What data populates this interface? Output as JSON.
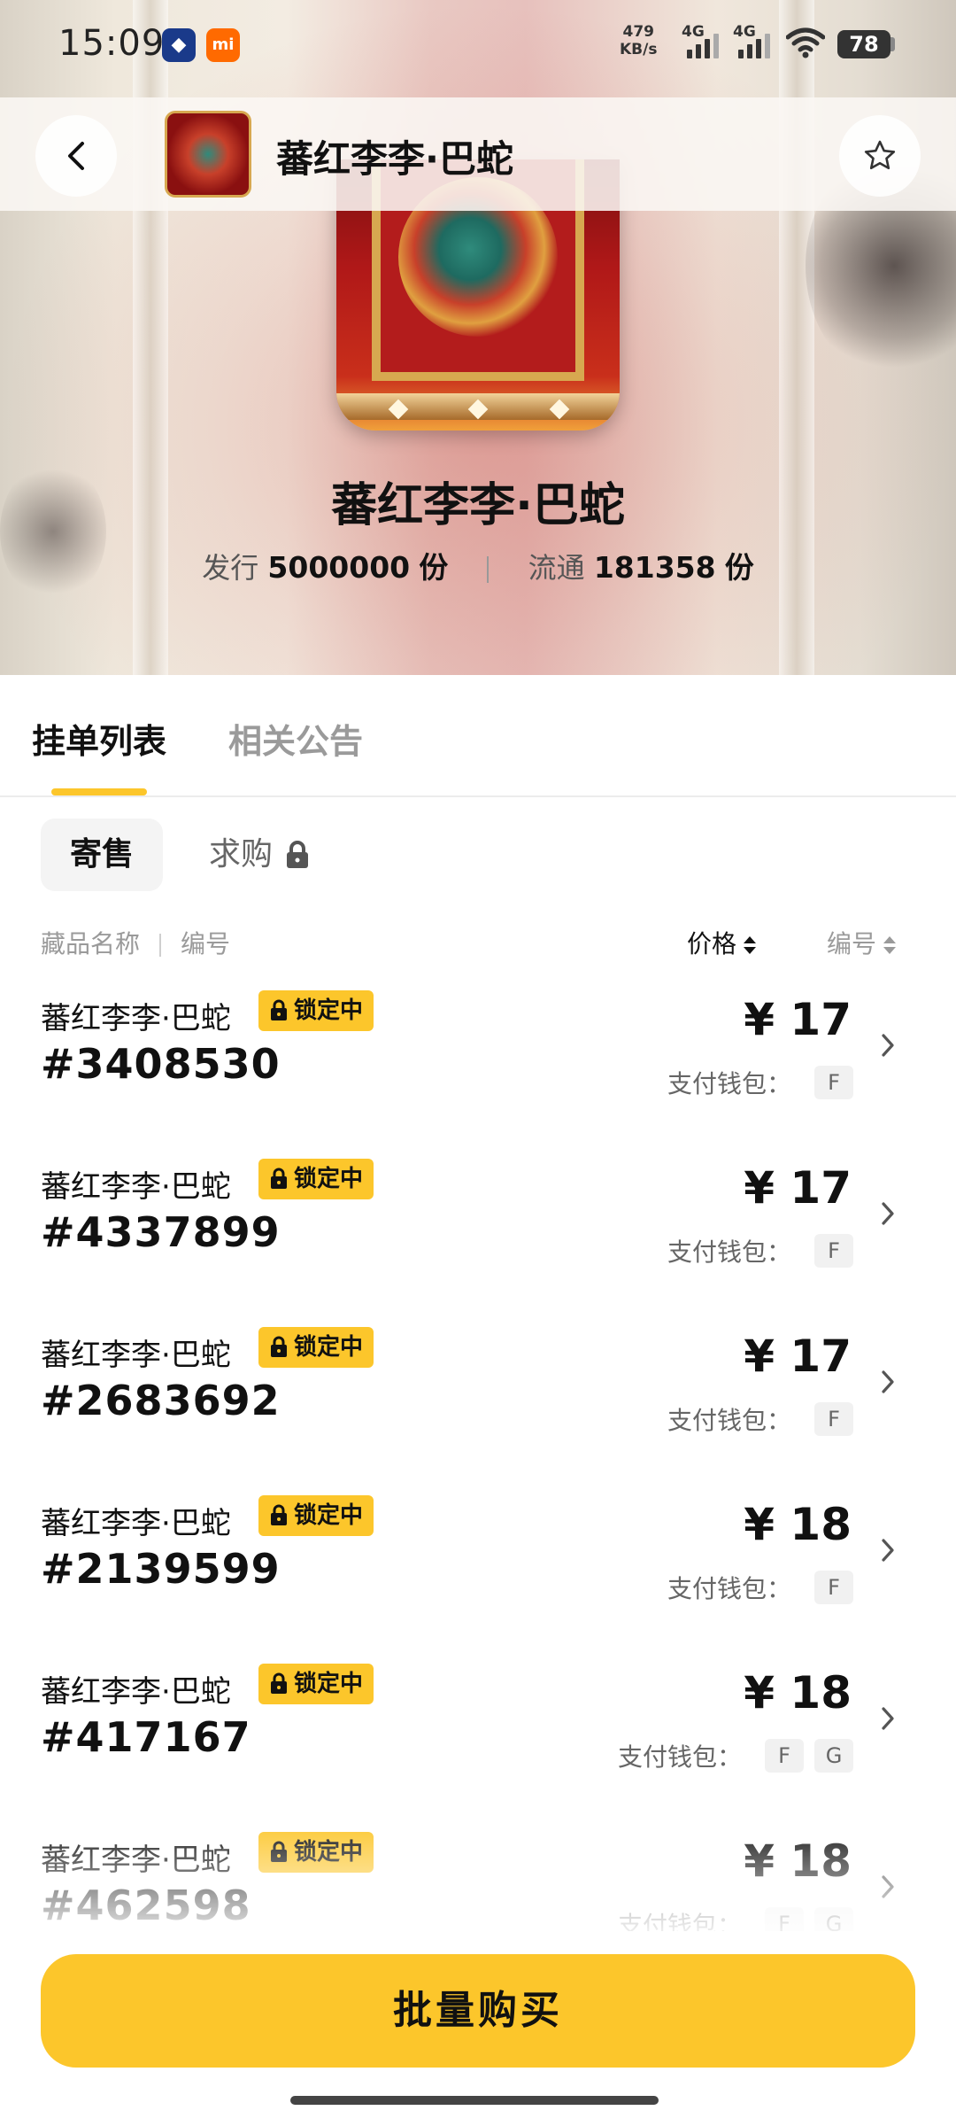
{
  "status_bar": {
    "time": "15:09",
    "app_icon_2": "mi",
    "net_speed_value": "479",
    "net_speed_unit": "KB/s",
    "signal1_label": "4G",
    "signal2_label": "4G",
    "battery": "78"
  },
  "header": {
    "title": "蕃红李李·巴蛇"
  },
  "item": {
    "name": "蕃红李李·巴蛇",
    "issue_label": "发行",
    "issue_count": "5000000",
    "circulation_label": "流通",
    "circulation_count": "181358",
    "unit": "份"
  },
  "tabs": [
    {
      "label": "挂单列表",
      "active": true
    },
    {
      "label": "相关公告",
      "active": false
    }
  ],
  "subtabs": {
    "sale_label": "寄售",
    "buy_label": "求购"
  },
  "columns": {
    "name": "藏品名称",
    "number": "编号",
    "price_sort": "价格",
    "number_sort": "编号"
  },
  "listing": {
    "lock_label": "锁定中",
    "wallet_label": "支付钱包：",
    "items": [
      {
        "name": "蕃红李李·巴蛇",
        "id": "#3408530",
        "price": "¥ 17",
        "wallets": [
          "F"
        ]
      },
      {
        "name": "蕃红李李·巴蛇",
        "id": "#4337899",
        "price": "¥ 17",
        "wallets": [
          "F"
        ]
      },
      {
        "name": "蕃红李李·巴蛇",
        "id": "#2683692",
        "price": "¥ 17",
        "wallets": [
          "F"
        ]
      },
      {
        "name": "蕃红李李·巴蛇",
        "id": "#2139599",
        "price": "¥ 18",
        "wallets": [
          "F"
        ]
      },
      {
        "name": "蕃红李李·巴蛇",
        "id": "#417167",
        "price": "¥ 18",
        "wallets": [
          "F",
          "G"
        ]
      },
      {
        "name": "蕃红李李·巴蛇",
        "id": "#462598",
        "price": "¥ 18",
        "wallets": [
          "F",
          "G"
        ]
      }
    ]
  },
  "bottom": {
    "bulk_buy_label": "批量购买"
  },
  "colors": {
    "accent": "#fcc62b",
    "text": "#111111",
    "muted": "#9a9a9a"
  }
}
